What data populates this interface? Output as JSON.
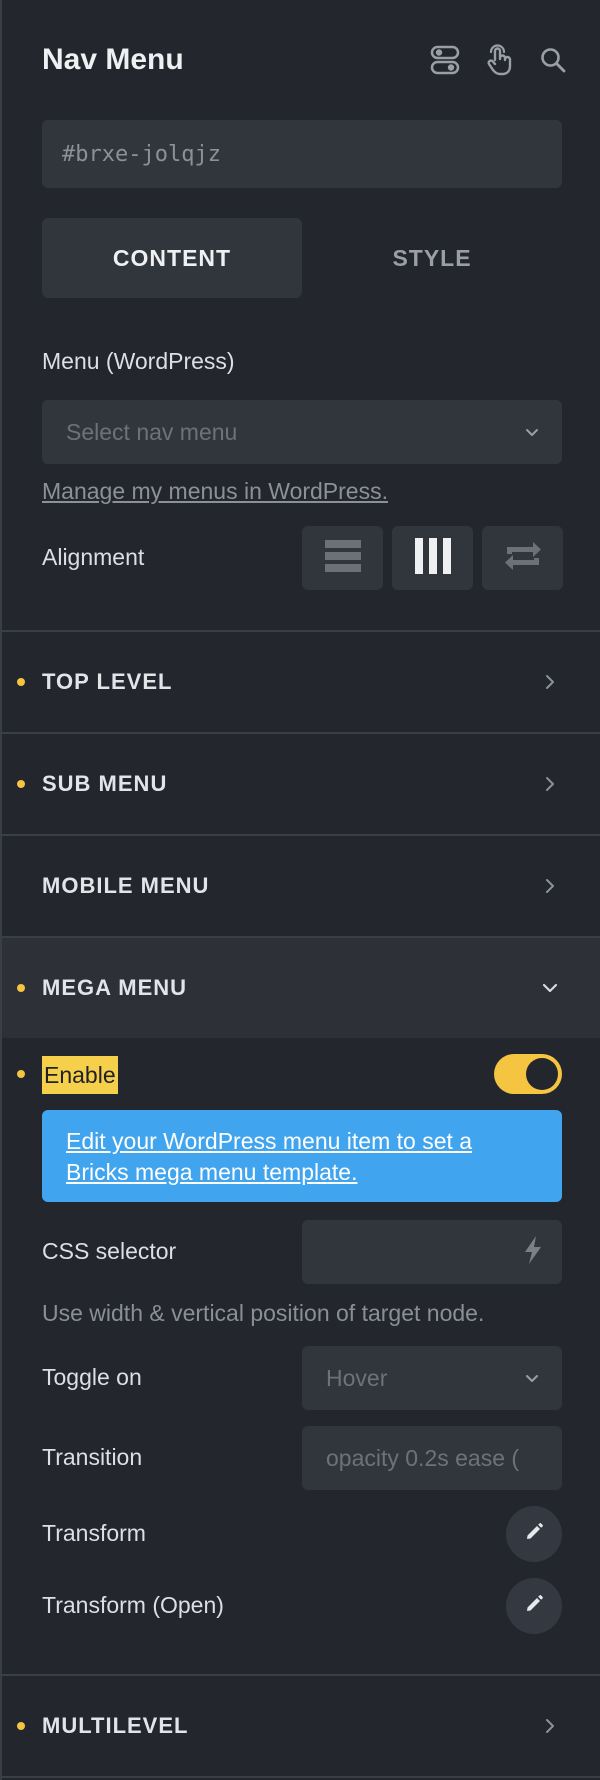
{
  "header": {
    "title": "Nav Menu",
    "icons": [
      "toggle-switch-icon",
      "pointer-hand-icon",
      "search-icon"
    ]
  },
  "element_id": "#brxe-jolqjz",
  "tabs": [
    {
      "label": "CONTENT",
      "active": true
    },
    {
      "label": "STYLE",
      "active": false
    }
  ],
  "menu": {
    "label": "Menu (WordPress)",
    "placeholder": "Select nav menu",
    "manage_link": "Manage my menus in WordPress."
  },
  "alignment": {
    "label": "Alignment",
    "options": [
      "rows-icon",
      "columns-icon",
      "reverse-icon"
    ]
  },
  "sections": {
    "top_level": {
      "title": "TOP LEVEL",
      "modified": true
    },
    "sub_menu": {
      "title": "SUB MENU",
      "modified": true
    },
    "mobile_menu": {
      "title": "MOBILE MENU",
      "modified": false
    },
    "mega_menu": {
      "title": "MEGA MENU",
      "modified": true,
      "open": true
    },
    "multilevel": {
      "title": "MULTILEVEL",
      "modified": true
    }
  },
  "mega": {
    "enable_label": "Enable",
    "enabled": true,
    "info": "Edit your WordPress menu item to set a Bricks mega menu template.",
    "css_selector_label": "CSS selector",
    "hint": "Use width & vertical position of target node.",
    "toggle_on_label": "Toggle on",
    "toggle_on_value": "Hover",
    "transition_label": "Transition",
    "transition_placeholder": "opacity 0.2s ease (",
    "transform_label": "Transform",
    "transform_open_label": "Transform (Open)"
  },
  "colors": {
    "background": "#23262c",
    "field": "#31353c",
    "accent_yellow": "#f5c542",
    "info_blue": "#40a4ee"
  }
}
